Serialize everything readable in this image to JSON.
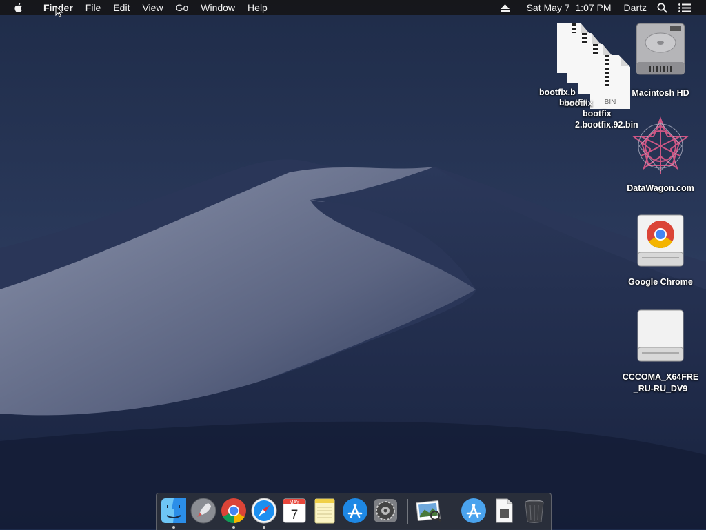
{
  "menubar": {
    "app_name": "Finder",
    "menus": [
      "File",
      "Edit",
      "View",
      "Go",
      "Window",
      "Help"
    ],
    "clock": "Sat May 7  1:07 PM",
    "user": "Dartz",
    "icons": [
      "apple-icon",
      "eject-icon",
      "spotlight-icon",
      "notification-center-icon"
    ]
  },
  "desktop": {
    "stacked_files": {
      "labels": [
        "bootfix.b",
        "bootfix",
        "bootfix",
        "bootfix",
        "2.bootfix.92.bin"
      ],
      "badge": "BIN"
    },
    "icons": [
      {
        "label": "Macintosh HD",
        "icon": "hard-drive-icon"
      },
      {
        "label": "DataWagon.com",
        "icon": "star-logo-icon"
      },
      {
        "label": "Google Chrome",
        "icon": "chrome-disk-icon"
      },
      {
        "label": "CCCOMA_X64FRE_RU-RU_DV9",
        "icon": "disk-image-icon"
      }
    ]
  },
  "dock": {
    "apps": [
      {
        "name": "Finder",
        "icon": "finder-icon",
        "running": true
      },
      {
        "name": "Launchpad",
        "icon": "launchpad-icon",
        "running": false
      },
      {
        "name": "Google Chrome",
        "icon": "chrome-icon",
        "running": true
      },
      {
        "name": "Safari",
        "icon": "safari-icon",
        "running": true
      },
      {
        "name": "Calendar",
        "icon": "calendar-icon",
        "running": false,
        "month": "MAY",
        "day": "7"
      },
      {
        "name": "Notes",
        "icon": "notes-icon",
        "running": false
      },
      {
        "name": "App Store",
        "icon": "app-store-icon",
        "running": false
      },
      {
        "name": "System Preferences",
        "icon": "system-preferences-icon",
        "running": false
      },
      {
        "name": "Preview",
        "icon": "preview-icon",
        "running": false
      },
      {
        "name": "Applications",
        "icon": "applications-folder-icon",
        "running": false
      },
      {
        "name": "Document",
        "icon": "document-icon",
        "running": false
      },
      {
        "name": "Trash",
        "icon": "trash-icon",
        "running": false
      }
    ]
  },
  "colors": {
    "sky": "#22304f",
    "dune": "#6f7791",
    "menubar": "#161618",
    "chrome_red": "#db4437",
    "chrome_green": "#0f9d58",
    "chrome_yellow": "#f4b400",
    "chrome_blue": "#4285f4",
    "datawagon_pink": "#e05a8a"
  }
}
